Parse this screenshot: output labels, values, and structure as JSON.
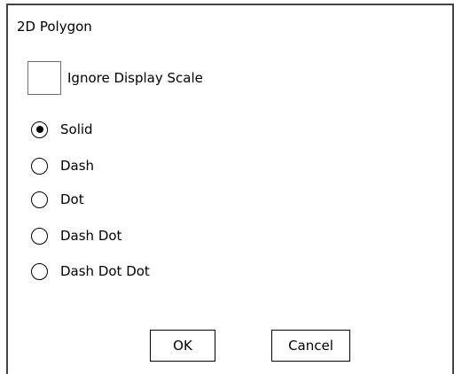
{
  "dialog": {
    "title": "2D Polygon",
    "ignore_display_scale": {
      "label": "Ignore Display Scale",
      "checked": false
    },
    "line_style": {
      "options": [
        {
          "label": "Solid",
          "selected": true
        },
        {
          "label": "Dash",
          "selected": false
        },
        {
          "label": "Dot",
          "selected": false
        },
        {
          "label": "Dash Dot",
          "selected": false
        },
        {
          "label": "Dash Dot Dot",
          "selected": false
        }
      ]
    },
    "buttons": {
      "ok_label": "OK",
      "cancel_label": "Cancel"
    }
  }
}
